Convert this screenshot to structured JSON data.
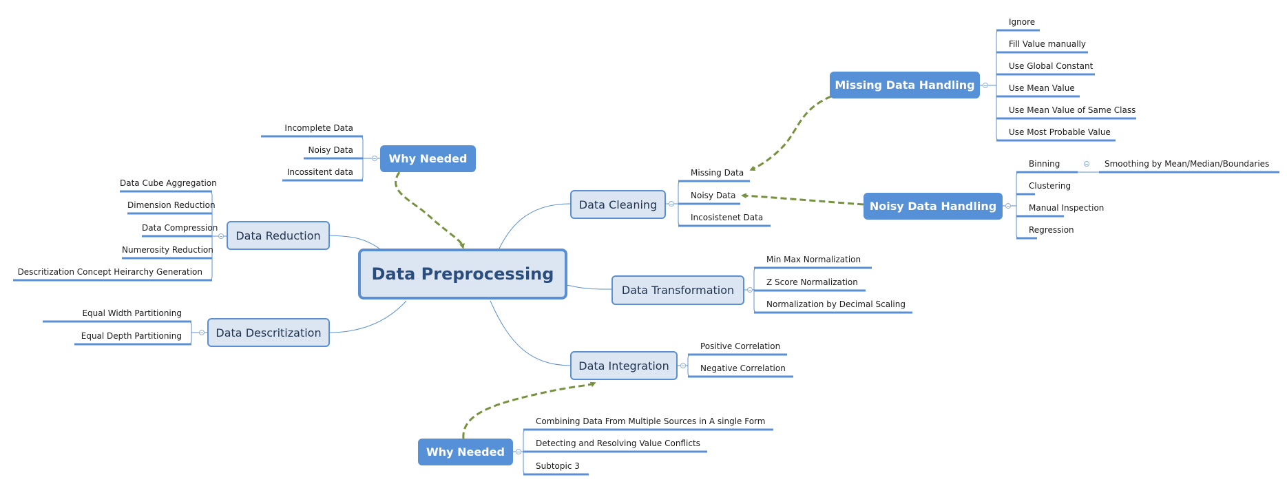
{
  "root": {
    "label": "Data Preprocessing"
  },
  "why_needed_top": {
    "label": "Why Needed",
    "items": [
      "Incomplete Data",
      "Noisy Data",
      "Incossitent data"
    ]
  },
  "data_reduction": {
    "label": "Data Reduction",
    "items": [
      "Data Cube Aggregation",
      "Dimension Reduction",
      "Data Compression",
      "Numerosity Reduction",
      "Descritization Concept Heirarchy Generation"
    ]
  },
  "data_descritization": {
    "label": "Data Descritization",
    "items": [
      "Equal Width Partitioning",
      "Equal Depth Partitioning"
    ]
  },
  "data_cleaning": {
    "label": "Data Cleaning",
    "items": [
      "Missing Data",
      "Noisy Data",
      "Incosistenet Data"
    ]
  },
  "data_transformation": {
    "label": "Data Transformation",
    "items": [
      "Min Max Normalization",
      "Z Score Normalization",
      "Normalization by Decimal Scaling"
    ]
  },
  "data_integration": {
    "label": "Data Integration",
    "items": [
      "Positive Correlation",
      "Negative Correlation"
    ]
  },
  "why_needed_bottom": {
    "label": "Why Needed",
    "items": [
      "Combining Data From Multiple Sources in A single Form",
      "Detecting and Resolving Value Conflicts",
      "Subtopic 3"
    ]
  },
  "missing_data_handling": {
    "label": "Missing Data Handling",
    "items": [
      "Ignore",
      "Fill Value manually",
      "Use Global Constant",
      "Use Mean Value",
      "Use Mean Value of Same Class",
      "Use Most Probable Value"
    ]
  },
  "noisy_data_handling": {
    "label": "Noisy Data Handling",
    "items": [
      "Binning",
      "Clustering",
      "Manual Inspection",
      "Regression"
    ],
    "binning_child": "Smoothing by Mean/Median/Boundaries"
  },
  "colors": {
    "branch_line": "#5b8fd4",
    "node_fill": "#dce6f2",
    "float_fill": "#5690d6",
    "relationship": "#76923c"
  }
}
